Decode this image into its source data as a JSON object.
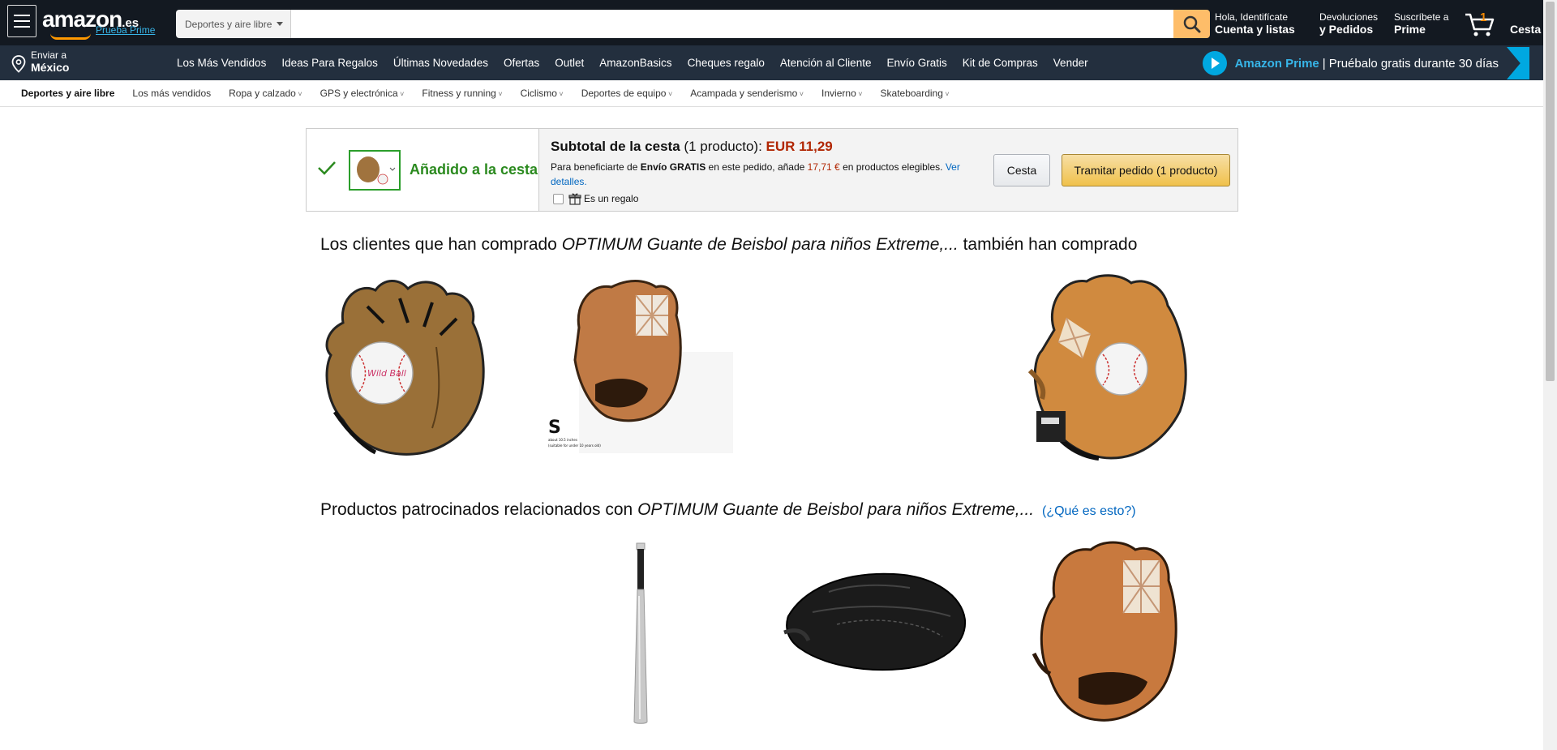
{
  "header": {
    "logo_text": "amazon",
    "logo_tld": ".es",
    "logo_prime": "Prueba Prime",
    "search_category": "Deportes y aire libre",
    "search_placeholder": "",
    "account_line1": "Hola, Identifícate",
    "account_line2": "Cuenta y listas",
    "returns_line1": "Devoluciones",
    "returns_line2": "y Pedidos",
    "prime_line1": "Suscríbete a",
    "prime_line2": "Prime",
    "cart_count": "1",
    "cart_label": "Cesta"
  },
  "navbar": {
    "deliver_line1": "Enviar a",
    "deliver_line2": "México",
    "items": [
      "Los Más Vendidos",
      "Ideas Para Regalos",
      "Últimas Novedades",
      "Ofertas",
      "Outlet",
      "AmazonBasics",
      "Cheques regalo",
      "Atención al Cliente",
      "Envío Gratis",
      "Kit de Compras",
      "Vender"
    ],
    "prime_name": "Amazon Prime",
    "prime_separator": "|",
    "prime_promo": "Pruébalo gratis durante 30 días"
  },
  "subnav": {
    "items": [
      {
        "label": "Deportes y aire libre",
        "dropdown": false,
        "active": true
      },
      {
        "label": "Los más vendidos",
        "dropdown": false,
        "active": false
      },
      {
        "label": "Ropa y calzado",
        "dropdown": true,
        "active": false
      },
      {
        "label": "GPS y electrónica",
        "dropdown": true,
        "active": false
      },
      {
        "label": "Fitness y running",
        "dropdown": true,
        "active": false
      },
      {
        "label": "Ciclismo",
        "dropdown": true,
        "active": false
      },
      {
        "label": "Deportes de equipo",
        "dropdown": true,
        "active": false
      },
      {
        "label": "Acampada y senderismo",
        "dropdown": true,
        "active": false
      },
      {
        "label": "Invierno",
        "dropdown": true,
        "active": false
      },
      {
        "label": "Skateboarding",
        "dropdown": true,
        "active": false
      }
    ]
  },
  "added": {
    "label": "Añadido a la cesta",
    "subtotal_label": "Subtotal de la cesta",
    "subtotal_count": "(1 producto):",
    "subtotal_price": "EUR 11,29",
    "ship_pre": "Para beneficiarte de",
    "ship_bold": "Envío GRATIS",
    "ship_mid": "en este pedido, añade",
    "ship_amount": "17,71 €",
    "ship_post": "en productos elegibles.",
    "ship_link": "Ver detalles.",
    "gift_label": "Es un regalo",
    "cart_button": "Cesta",
    "checkout_button": "Tramitar pedido (1 producto)"
  },
  "also_bought": {
    "title_pre": "Los clientes que han comprado",
    "title_product": "OPTIMUM Guante de Beisbol para niños Extreme,...",
    "title_post": "también han comprado",
    "image2_caption_big": "S",
    "image2_caption_small1": "about 10.5 inches",
    "image2_caption_small2": "(suitable for under 10 years old)"
  },
  "sponsored": {
    "title_pre": "Productos patrocinados relacionados con",
    "title_product": "OPTIMUM Guante de Beisbol para niños Extreme,...",
    "what_is": "(¿Qué es esto?)"
  },
  "colors": {
    "header_bg": "#131921",
    "nav_bg": "#232f3e",
    "prime_blue": "#00a8e1",
    "price_red": "#b12704",
    "added_green": "#2b8a1f",
    "link_blue": "#0066c0"
  }
}
